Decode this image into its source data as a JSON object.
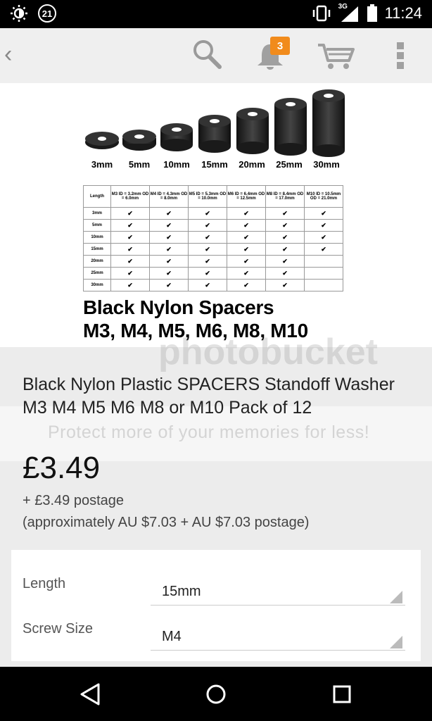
{
  "status_bar": {
    "notification_count": "21",
    "network": "3G",
    "time": "11:24"
  },
  "app_bar": {
    "back_icon": "chevron-left-icon",
    "cart_badge": "3"
  },
  "product_image": {
    "sizes": [
      "3mm",
      "5mm",
      "10mm",
      "15mm",
      "20mm",
      "25mm",
      "30mm"
    ],
    "table_header": [
      "Length",
      "M3 ID = 3.2mm OD = 6.0mm",
      "M4 ID = 4.3mm OD = 8.0mm",
      "M5 ID = 5.3mm OD = 10.0mm",
      "M6 ID = 6.4mm OD = 12.5mm",
      "M8 ID = 8.4mm OD = 17.0mm",
      "M10 ID = 10.5mm OD = 21.0mm"
    ],
    "table_rows": [
      {
        "length": "3mm",
        "marks": [
          "✔",
          "✔",
          "✔",
          "✔",
          "✔",
          "✔"
        ]
      },
      {
        "length": "5mm",
        "marks": [
          "✔",
          "✔",
          "✔",
          "✔",
          "✔",
          "✔"
        ]
      },
      {
        "length": "10mm",
        "marks": [
          "✔",
          "✔",
          "✔",
          "✔",
          "✔",
          "✔"
        ]
      },
      {
        "length": "15mm",
        "marks": [
          "✔",
          "✔",
          "✔",
          "✔",
          "✔",
          "✔"
        ]
      },
      {
        "length": "20mm",
        "marks": [
          "✔",
          "✔",
          "✔",
          "✔",
          "✔",
          ""
        ]
      },
      {
        "length": "25mm",
        "marks": [
          "✔",
          "✔",
          "✔",
          "✔",
          "✔",
          ""
        ]
      },
      {
        "length": "30mm",
        "marks": [
          "✔",
          "✔",
          "✔",
          "✔",
          "✔",
          ""
        ]
      }
    ],
    "title_line1": "Black Nylon Spacers",
    "title_line2": "M3, M4, M5, M6, M8, M10"
  },
  "watermark": {
    "logo": "photobucket",
    "text": "Protect more of your memories for less!"
  },
  "product": {
    "title": "Black Nylon Plastic SPACERS Standoff Washer M3 M4 M5 M6 M8 or M10 Pack of 12",
    "price": "£3.49",
    "postage": "+ £3.49 postage",
    "approx": "(approximately AU $7.03 + AU $7.03 postage)"
  },
  "options": {
    "length_label": "Length",
    "length_value": "15mm",
    "screw_label": "Screw Size",
    "screw_value": "M4"
  }
}
